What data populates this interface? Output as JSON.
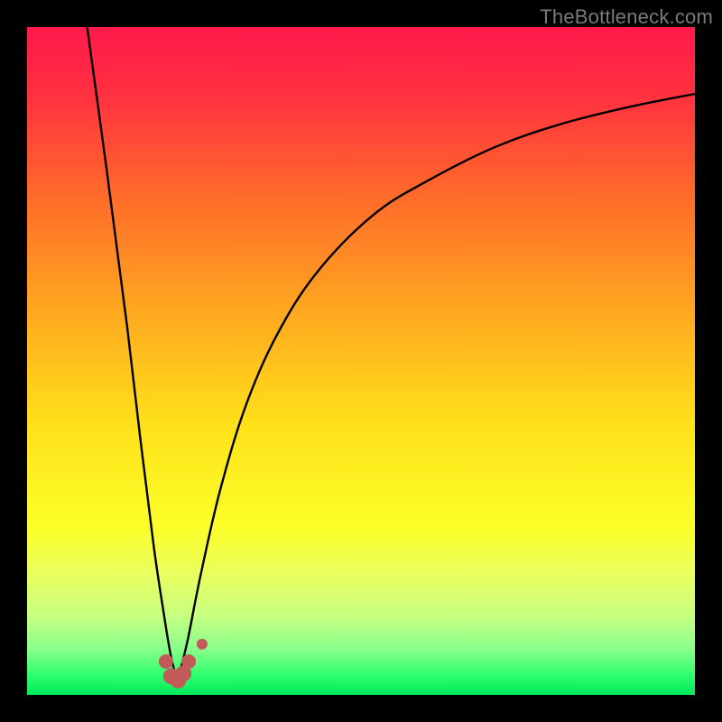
{
  "watermark": {
    "text": "TheBottleneck.com"
  },
  "gradient": {
    "stops": [
      {
        "offset": 0.0,
        "color": "#ff1a4b"
      },
      {
        "offset": 0.1,
        "color": "#ff3040"
      },
      {
        "offset": 0.25,
        "color": "#ff6a2a"
      },
      {
        "offset": 0.45,
        "color": "#ffb01f"
      },
      {
        "offset": 0.6,
        "color": "#ffe21a"
      },
      {
        "offset": 0.75,
        "color": "#fbff2a"
      },
      {
        "offset": 0.82,
        "color": "#eaff60"
      },
      {
        "offset": 0.88,
        "color": "#c8ff80"
      },
      {
        "offset": 0.93,
        "color": "#8cff8c"
      },
      {
        "offset": 0.97,
        "color": "#30ff70"
      },
      {
        "offset": 1.0,
        "color": "#00e85a"
      }
    ]
  },
  "chart_data": {
    "type": "line",
    "title": "",
    "xlabel": "",
    "ylabel": "",
    "xlim": [
      0,
      100
    ],
    "ylim": [
      0,
      100
    ],
    "axes_visible": false,
    "note": "x and y are in percent of the plotting area (0–100). y = bottleneck magnitude (0 at bottom/green, 100 at top/red). Minimum (ideal balance) occurs near x≈22.",
    "series": [
      {
        "name": "left-branch",
        "x": [
          9.0,
          12.0,
          15.0,
          17.0,
          19.0,
          20.5,
          21.5,
          22.5
        ],
        "y": [
          100.0,
          78.0,
          55.0,
          38.0,
          22.0,
          12.0,
          6.0,
          2.0
        ]
      },
      {
        "name": "right-branch",
        "x": [
          22.5,
          24.0,
          26.0,
          29.0,
          33.0,
          38.0,
          44.0,
          52.0,
          60.0,
          70.0,
          80.0,
          90.0,
          100.0
        ],
        "y": [
          2.0,
          8.0,
          18.0,
          31.0,
          44.0,
          55.0,
          64.0,
          72.0,
          77.0,
          82.0,
          85.5,
          88.0,
          90.0
        ]
      }
    ],
    "markers": {
      "name": "highlight-points",
      "color": "#c25a5a",
      "points": [
        {
          "x": 20.8,
          "y": 5.0,
          "r": 8
        },
        {
          "x": 21.6,
          "y": 2.8,
          "r": 9
        },
        {
          "x": 22.6,
          "y": 2.2,
          "r": 9
        },
        {
          "x": 23.4,
          "y": 3.2,
          "r": 9
        },
        {
          "x": 24.2,
          "y": 5.0,
          "r": 8
        },
        {
          "x": 26.2,
          "y": 7.6,
          "r": 6
        }
      ]
    }
  }
}
